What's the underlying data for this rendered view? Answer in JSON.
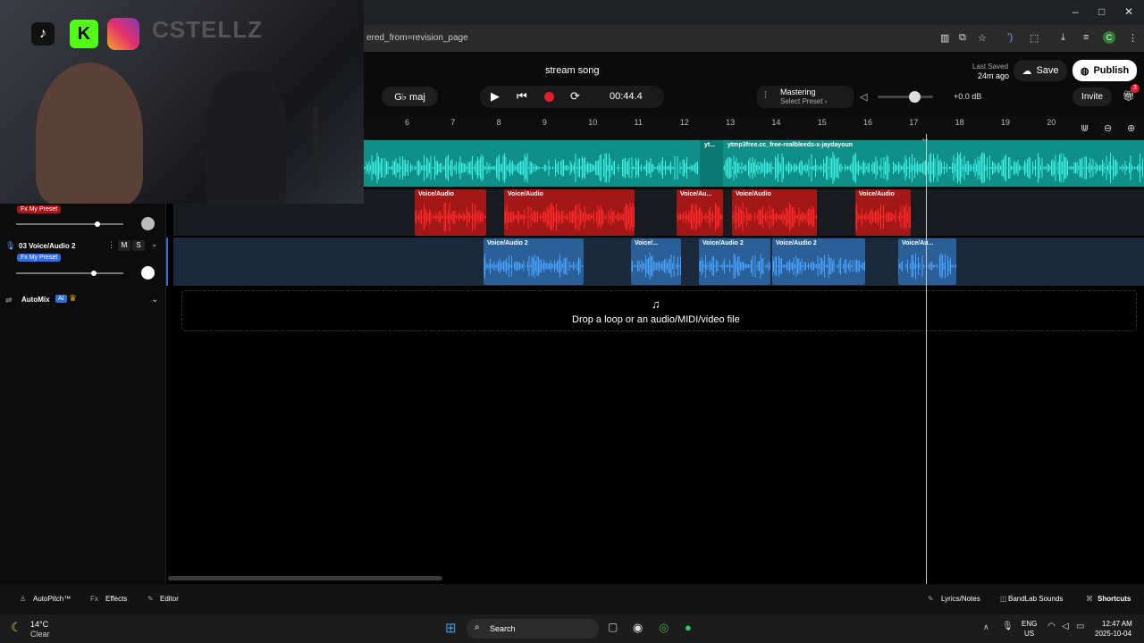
{
  "browser": {
    "url": "ered_from=revision_page",
    "profile_initial": "C",
    "window_controls": [
      "–",
      "□",
      "✕"
    ]
  },
  "webcam": {
    "streamer_name": "CSTELLZ",
    "social_icons": [
      "tiktok-icon",
      "kick-icon",
      "instagram-icon"
    ]
  },
  "header": {
    "project_title": "stream song",
    "key": "G♭ maj",
    "time": "00:44.4",
    "mastering_label": "Mastering",
    "mastering_preset": "Select Preset ›",
    "volume_db": "+0.0 dB",
    "last_saved_label": "Last Saved",
    "last_saved_time": "24m ago",
    "save_label": "Save",
    "publish_label": "Publish",
    "invite_label": "Invite",
    "notification_count": "3"
  },
  "ruler": {
    "ticks": [
      "6",
      "7",
      "8",
      "9",
      "10",
      "11",
      "12",
      "13",
      "14",
      "15",
      "16",
      "17",
      "18",
      "19",
      "20"
    ]
  },
  "tracks": {
    "track1": {
      "clip_labels": [
        "yt...",
        "ytmp3free.cc_free-realbleeds-x-jaydayoun"
      ]
    },
    "track2": {
      "fx_label": "Fx My Preset",
      "clips": [
        "Voice/Audio",
        "Voice/Audio",
        "Voice/Au...",
        "Voice/Audio",
        "Voice/Audio"
      ]
    },
    "track3": {
      "name": "03  Voice/Audio 2",
      "mute": "M",
      "solo": "S",
      "fx_label": "Fx My Preset",
      "clips": [
        "Voice/Audio 2",
        "Voice/...",
        "Voice/Audio 2",
        "Voice/Audio 2",
        "Voice/Au..."
      ]
    }
  },
  "automix": {
    "label": "AutoMix",
    "badge": "AI"
  },
  "dropzone": {
    "text": "Drop a loop or an audio/MIDI/video file"
  },
  "bottom_bar": {
    "autopitch": "AutoPitch™",
    "effects": "Effects",
    "editor": "Editor",
    "lyrics": "Lyrics/Notes",
    "sounds": "BandLab Sounds",
    "shortcuts": "Shortcuts"
  },
  "taskbar": {
    "weather_temp": "14°C",
    "weather_desc": "Clear",
    "search_label": "Search",
    "lang": "ENG",
    "region": "US",
    "time": "12:47 AM",
    "date": "2025-10-04"
  },
  "colors": {
    "track1": "#0f8f88",
    "clip_red": "#a31717",
    "clip_blue": "#2a5f97",
    "record": "#e11d2a"
  }
}
